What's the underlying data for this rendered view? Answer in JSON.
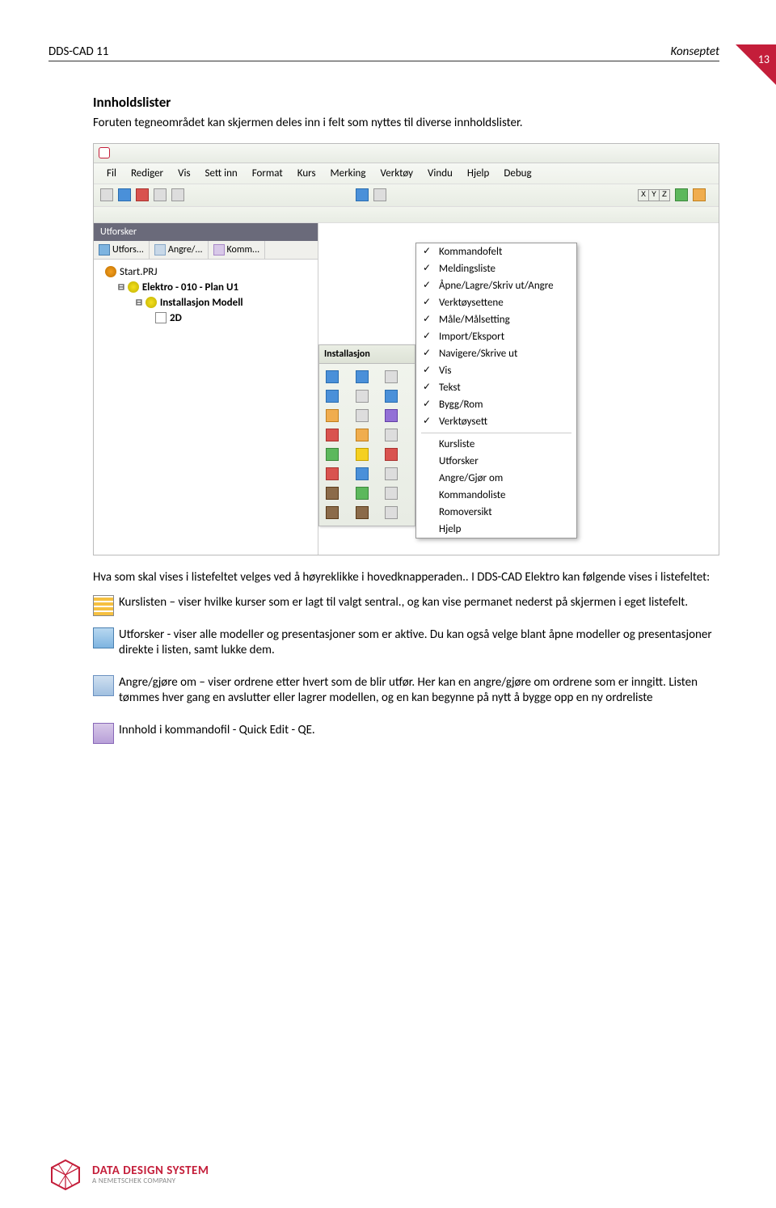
{
  "page_number": "13",
  "header": {
    "left": "DDS-CAD 11",
    "right": "Konseptet"
  },
  "section_title": "Innholdslister",
  "intro_text": "Foruten tegneområdet kan skjermen deles inn i felt som nyttes til diverse innholdslister.",
  "app": {
    "menubar": [
      "Fil",
      "Rediger",
      "Vis",
      "Sett inn",
      "Format",
      "Kurs",
      "Merking",
      "Verktøy",
      "Vindu",
      "Hjelp",
      "Debug"
    ],
    "panel_title": "Utforsker",
    "panel_tabs": [
      {
        "label": "Utfors...",
        "icon": "ex"
      },
      {
        "label": "Angre/...",
        "icon": "un"
      },
      {
        "label": "Komm...",
        "icon": "cm"
      }
    ],
    "tree": {
      "item1": "Start.PRJ",
      "item2": "Elektro - 010 - Plan U1",
      "item3": "Installasjon Modell",
      "item4": "2D"
    },
    "toolbox_title": "Installasjon",
    "context_menu": {
      "group1": [
        "Kommandofelt",
        "Meldingsliste",
        "Åpne/Lagre/Skriv ut/Angre",
        "Verktøysettene",
        "Måle/Målsetting",
        "Import/Eksport",
        "Navigere/Skrive ut",
        "Vis",
        "Tekst",
        "Bygg/Rom",
        "Verktøysett"
      ],
      "group2": [
        "Kursliste",
        "Utforsker",
        "Angre/Gjør om",
        "Kommandoliste",
        "Romoversikt",
        "Hjelp"
      ]
    }
  },
  "para_after": "Hva som skal vises i listefeltet velges ved å høyreklikke i hovedknapperaden.. I DDS-CAD Elektro kan følgende vises i listefeltet:",
  "items": [
    {
      "icon": "grid",
      "text": " Kurslisten – viser hvilke kurser som er lagt til valgt sentral., og kan vise permanet nederst på skjermen i eget listefelt."
    },
    {
      "icon": "explorer",
      "text": " Utforsker - viser alle modeller og presentasjoner som er aktive. Du kan også velge blant åpne modeller og presentasjoner direkte i listen, samt lukke dem."
    },
    {
      "icon": "undo",
      "text": " Angre/gjøre om – viser ordrene etter hvert som de blir utfør. Her kan en angre/gjøre om ordrene som er inngitt. Listen tømmes hver gang en avslutter eller lagrer modellen, og en kan begynne på nytt å bygge opp en ny ordreliste"
    },
    {
      "icon": "cmd",
      "text": " Innhold i kommandofil - Quick Edit - QE."
    }
  ],
  "footer": {
    "title": "DATA DESIGN SYSTEM",
    "sub": "A NEMETSCHEK COMPANY"
  }
}
